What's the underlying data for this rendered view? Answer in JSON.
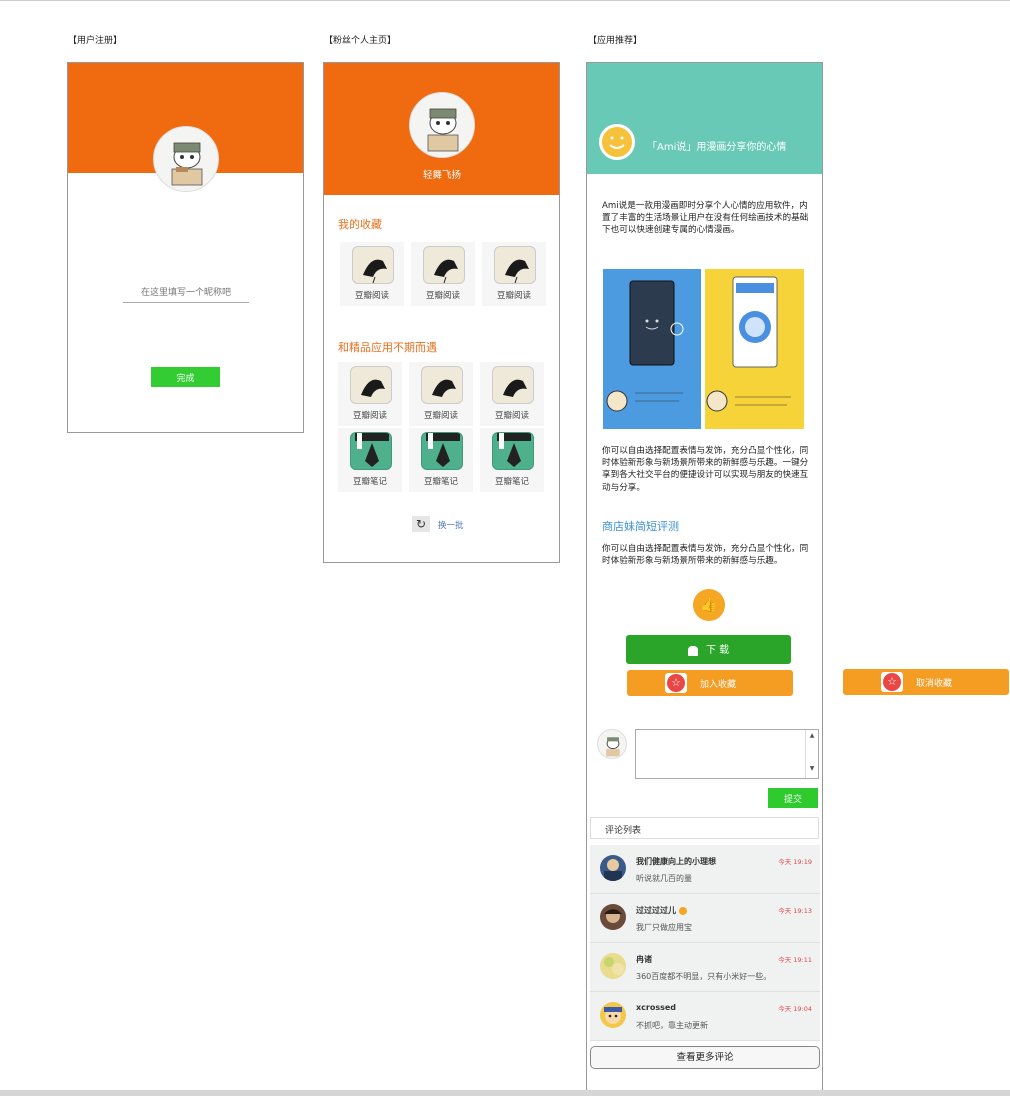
{
  "sections": {
    "register": "【用户注册】",
    "fan_home": "【粉丝个人主页】",
    "app_recommend": "【应用推荐】"
  },
  "register": {
    "nickname_placeholder": "在这里填写一个昵称吧",
    "done_label": "完成"
  },
  "fan": {
    "username": "轻舞飞扬",
    "favorites_title": "我的收藏",
    "favorites": [
      "豆瓣阅读",
      "豆瓣阅读",
      "豆瓣阅读"
    ],
    "meet_title": "和精品应用不期而遇",
    "apps_row1": [
      "豆瓣阅读",
      "豆瓣阅读",
      "豆瓣阅读"
    ],
    "apps_row2": [
      "豆瓣笔记",
      "豆瓣笔记",
      "豆瓣笔记"
    ],
    "refresh_label": "换一批"
  },
  "app": {
    "header_title": "「Ami说」用漫画分享你的心情",
    "desc1": "Ami说是一款用漫画即时分享个人心情的应用软件，内置了丰富的生活场景让用户在没有任何绘画技术的基础下也可以快速创建专属的心情漫画。",
    "desc2": "你可以自由选择配置表情与发饰，充分凸显个性化，同时体验新形象与新场景所带来的新鲜感与乐趣。一键分享到各大社交平台的便捷设计可以实现与朋友的快速互动与分享。",
    "review_title": "商店妹简短评测",
    "review_text": "你可以自由选择配置表情与发饰，充分凸显个性化，同时体验新形象与新场景所带来的新鲜感与乐趣。",
    "download_label": "下 载",
    "add_fav_label": "加入收藏",
    "cancel_fav_label": "取消收藏",
    "submit_label": "提交",
    "comment_list_label": "评论列表",
    "more_comments_label": "查看更多评论",
    "comments": [
      {
        "name": "我们健康向上的小理想",
        "text": "听说就几百的量",
        "time": "今天 19:19"
      },
      {
        "name": "过过过过儿",
        "text": "我厂只做应用宝",
        "time": "今天 19:13"
      },
      {
        "name": "冉诸",
        "text": "360百度都不明显，只有小米好一些。",
        "time": "今天 19:11"
      },
      {
        "name": "xcrossed",
        "text": "不抓吧，靠主动更新",
        "time": "今天 19:04"
      }
    ],
    "colors": {
      "header": "#69c9b7",
      "download": "#2aa52a",
      "orange": "#f59c23"
    }
  },
  "colors": {
    "brand_orange": "#f06a0f",
    "green": "#33cc33"
  }
}
